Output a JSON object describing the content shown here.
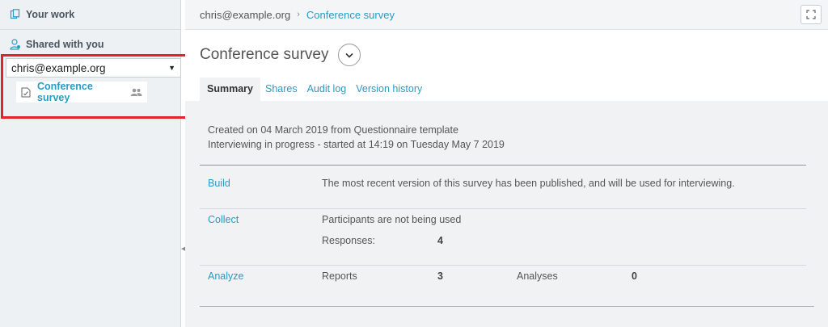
{
  "sidebar": {
    "your_work": "Your work",
    "shared_with_you": "Shared with you",
    "account_select": {
      "value": "chris@example.org"
    },
    "survey_item": {
      "label": "Conference survey"
    }
  },
  "breadcrumb": {
    "root": "chris@example.org",
    "separator": "›",
    "current": "Conference survey"
  },
  "main": {
    "title": "Conference survey",
    "tabs": [
      {
        "label": "Summary",
        "active": true
      },
      {
        "label": "Shares",
        "active": false
      },
      {
        "label": "Audit log",
        "active": false
      },
      {
        "label": "Version history",
        "active": false
      }
    ],
    "meta": {
      "created": "Created on 04 March 2019 from Questionnaire template",
      "status": "Interviewing in progress - started at 14:19 on Tuesday May 7 2019"
    },
    "sections": {
      "build": {
        "link": "Build",
        "text": "The most recent version of this survey has been published, and will be used for interviewing."
      },
      "collect": {
        "link": "Collect",
        "participants_text": "Participants are not being used",
        "responses_label": "Responses:",
        "responses_value": "4"
      },
      "analyze": {
        "link": "Analyze",
        "reports_label": "Reports",
        "reports_value": "3",
        "analyses_label": "Analyses",
        "analyses_value": "0"
      }
    }
  },
  "colors": {
    "accent": "#2a9bc4",
    "highlight": "#e0242b",
    "sidebar_bg": "#eef1f4",
    "panel_bg": "#f0f2f4"
  }
}
